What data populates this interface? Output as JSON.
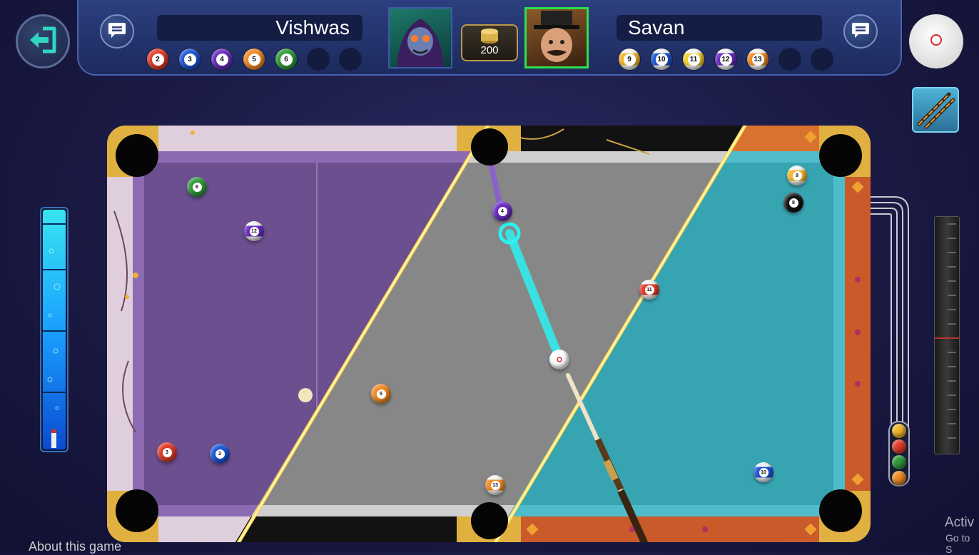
{
  "players": {
    "left": {
      "name": "Vishwas",
      "balls": [
        {
          "n": "2",
          "color": "#2d5fd6",
          "stripe": false,
          "c": "#e23b2a"
        },
        {
          "n": "3",
          "color": "#2d5fd6",
          "stripe": false,
          "c": "#1b55d6"
        },
        {
          "n": "4",
          "color": "#6a2bc2",
          "stripe": false,
          "c": "#6a2bc2"
        },
        {
          "n": "5",
          "color": "#f08a24",
          "stripe": false,
          "c": "#f08a24"
        },
        {
          "n": "6",
          "color": "#2e9a3a",
          "stripe": false,
          "c": "#2e9a3a"
        }
      ],
      "empty_slots": 2
    },
    "right": {
      "name": "Savan",
      "balls": [
        {
          "n": "9",
          "stripe": true,
          "c": "#f2b52a"
        },
        {
          "n": "10",
          "stripe": true,
          "c": "#1b55d6"
        },
        {
          "n": "11",
          "stripe": true,
          "c": "#f2d12a"
        },
        {
          "n": "12",
          "stripe": true,
          "c": "#6a2bc2"
        },
        {
          "n": "13",
          "stripe": true,
          "c": "#f08a24"
        }
      ],
      "empty_slots": 2
    }
  },
  "pot": {
    "amount": "200",
    "icon": "coin-stack-icon"
  },
  "table_balls": [
    {
      "n": "6",
      "stripe": false,
      "c": "#2e9a3a"
    },
    {
      "n": "12",
      "stripe": true,
      "c": "#6a2bc2"
    },
    {
      "n": "4",
      "stripe": false,
      "c": "#6a2bc2"
    },
    {
      "n": "5",
      "stripe": false,
      "c": "#f08a24"
    },
    {
      "n": "3",
      "stripe": false,
      "c": "#e23b2a"
    },
    {
      "n": "2",
      "stripe": false,
      "c": "#1b55d6"
    },
    {
      "n": "9",
      "stripe": true,
      "c": "#f2b52a"
    },
    {
      "n": "",
      "stripe": false,
      "c": "#ffffff",
      "cue": true
    },
    {
      "n": "11",
      "stripe": true,
      "c": "#e23b2a"
    },
    {
      "n": "13",
      "stripe": true,
      "c": "#f08a24"
    },
    {
      "n": "8",
      "stripe": false,
      "c": "#111111"
    },
    {
      "n": "10",
      "stripe": true,
      "c": "#1b55d6"
    }
  ],
  "rack_balls": [
    {
      "n": "",
      "c": "#f2b52a"
    },
    {
      "n": "",
      "c": "#e23b2a"
    },
    {
      "n": "",
      "c": "#2e9a3a"
    },
    {
      "n": "",
      "c": "#f08a24"
    }
  ],
  "overlay": {
    "activate": "Activ",
    "goto": "Go to S",
    "about": "About this game"
  }
}
